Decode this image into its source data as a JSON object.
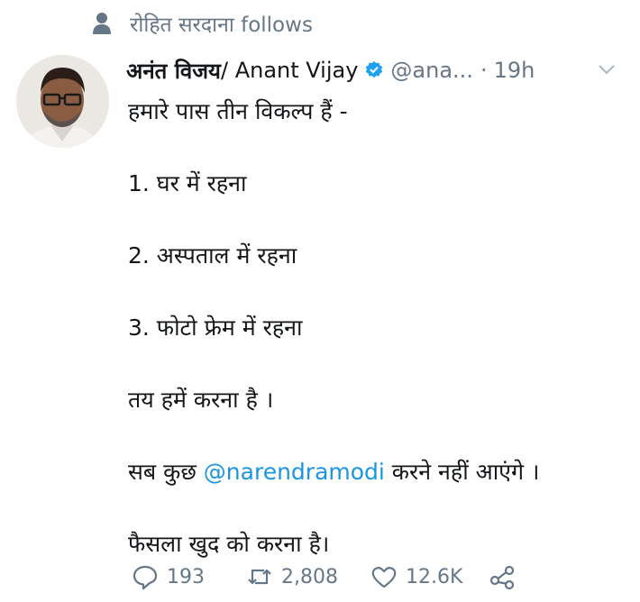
{
  "social_context": {
    "icon": "person-icon",
    "text": "रोहित सरदाना follows"
  },
  "tweet": {
    "author_name_hindi": "अनंत विजय",
    "author_name_latin": "/ Anant Vijay",
    "handle": "@ana...",
    "separator": "·",
    "time": "19h",
    "verified": true,
    "lines": [
      "हमारे पास तीन विकल्प हैं -",
      "",
      "1. घर में रहना",
      "",
      "2. अस्पताल में रहना",
      "",
      "3. फोटो फ्रेम में रहना",
      "",
      "तय हमें करना है  ।",
      ""
    ],
    "mention_line": {
      "before": "सब कुछ ",
      "mention": "@narendramodi",
      "after": " करने नहीं आएंगे ।"
    },
    "last_line": "फैसला खुद को करना है।"
  },
  "actions": {
    "reply_count": "193",
    "retweet_count": "2,808",
    "like_count": "12.6K"
  },
  "colors": {
    "accent": "#1b95e0",
    "muted": "#657786",
    "text": "#14171a"
  }
}
